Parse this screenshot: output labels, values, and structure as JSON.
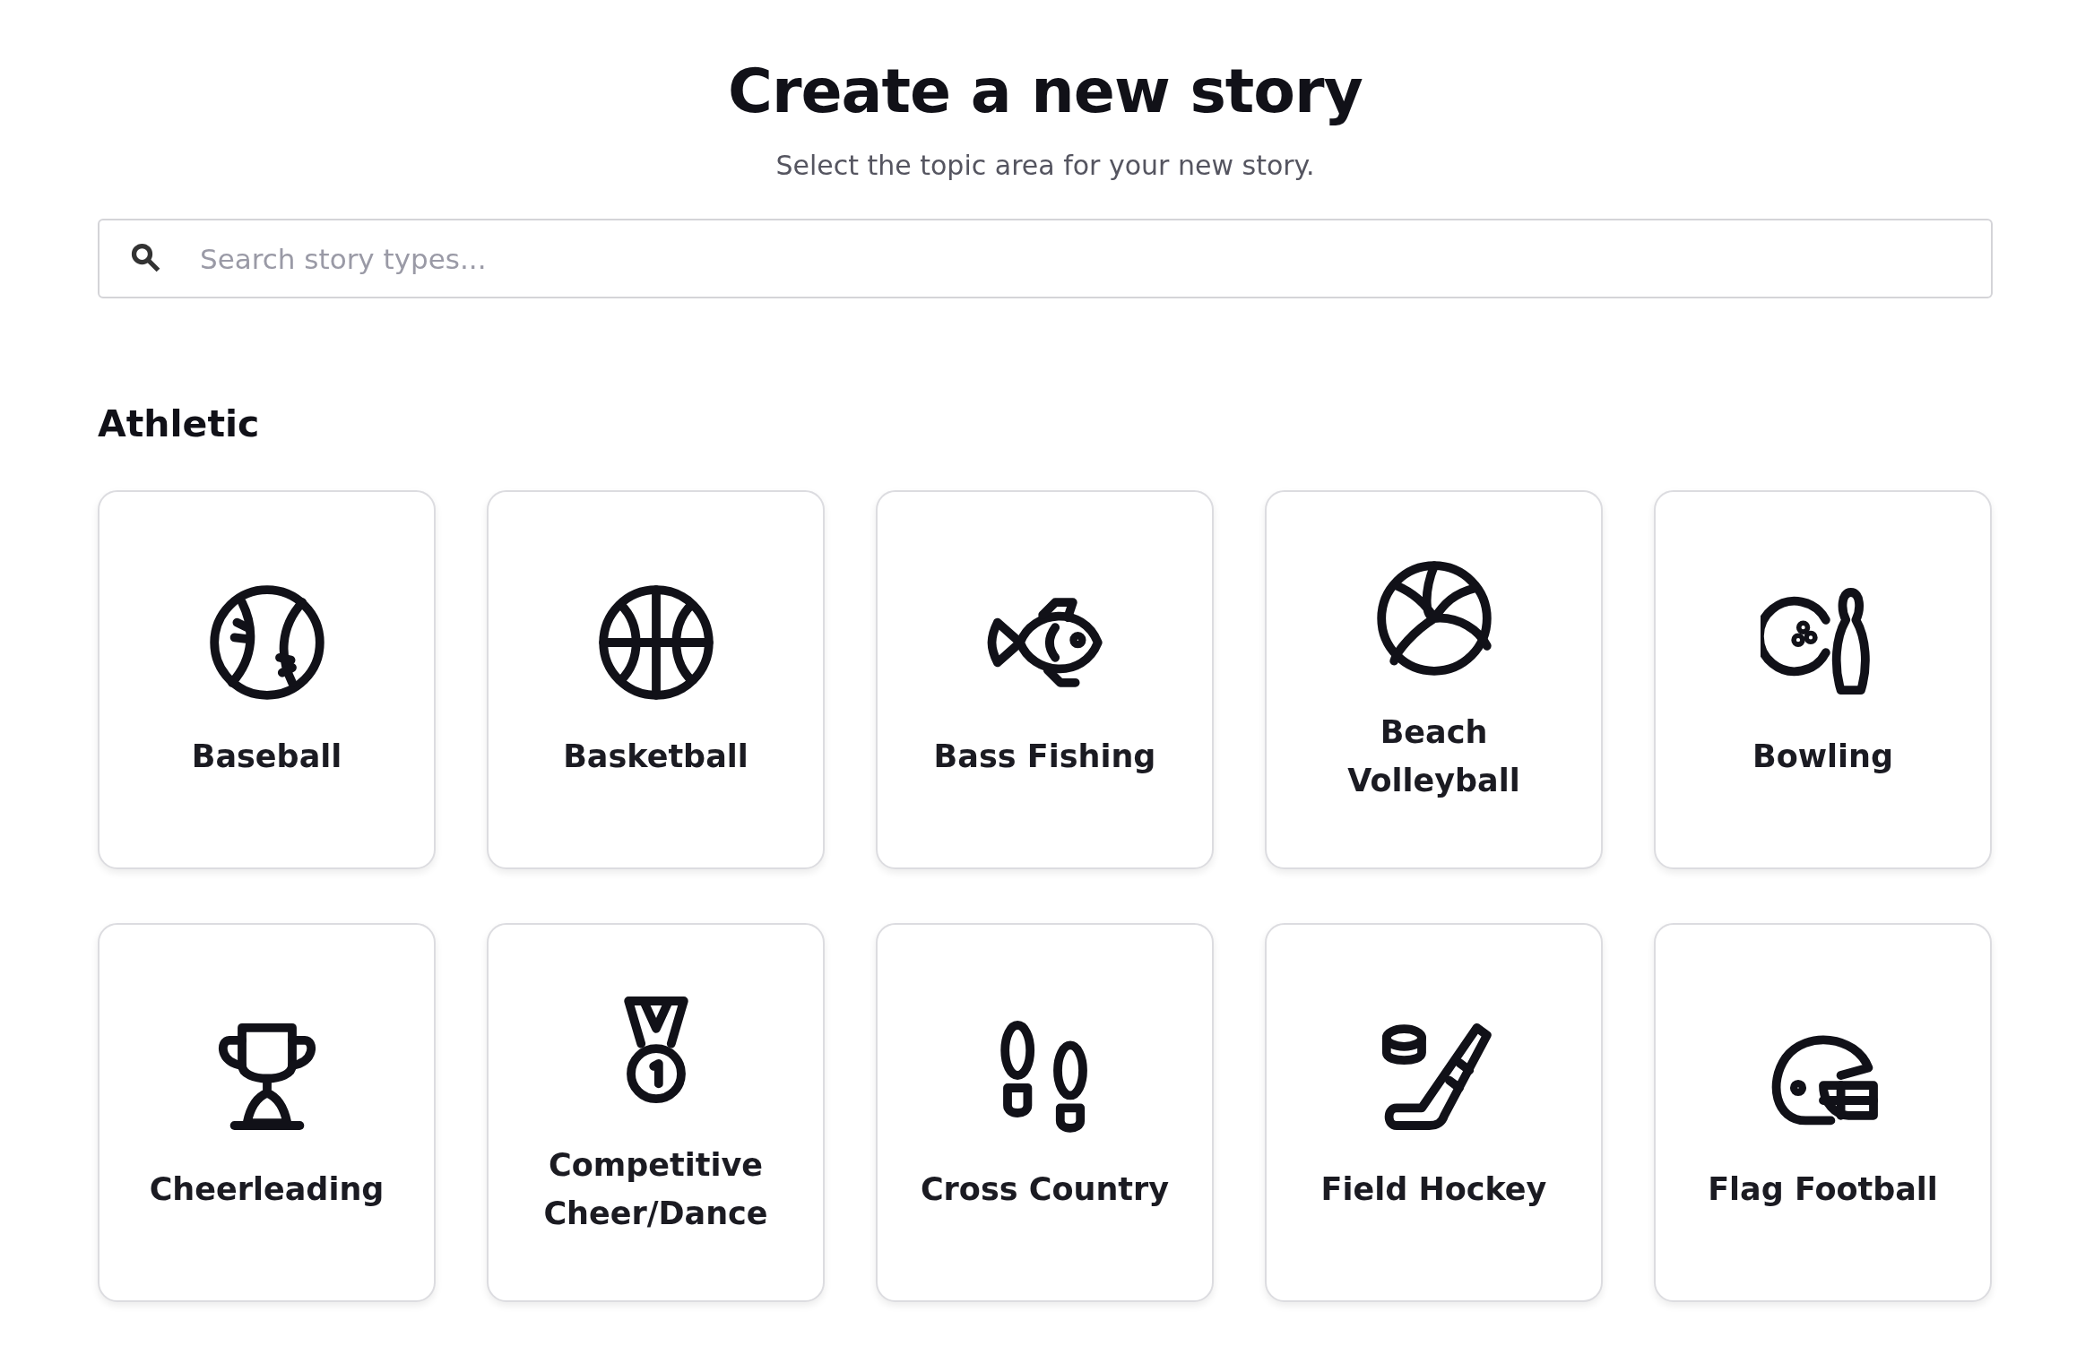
{
  "header": {
    "title": "Create a new story",
    "subtitle": "Select the topic area for your new story."
  },
  "search": {
    "placeholder": "Search story types..."
  },
  "sections": [
    {
      "title": "Athletic",
      "cards": [
        {
          "label": "Baseball"
        },
        {
          "label": "Basketball"
        },
        {
          "label": "Bass Fishing"
        },
        {
          "label": "Beach Volleyball"
        },
        {
          "label": "Bowling"
        },
        {
          "label": "Cheerleading"
        },
        {
          "label": "Competitive Cheer/Dance"
        },
        {
          "label": "Cross Country"
        },
        {
          "label": "Field Hockey"
        },
        {
          "label": "Flag Football"
        }
      ]
    }
  ]
}
